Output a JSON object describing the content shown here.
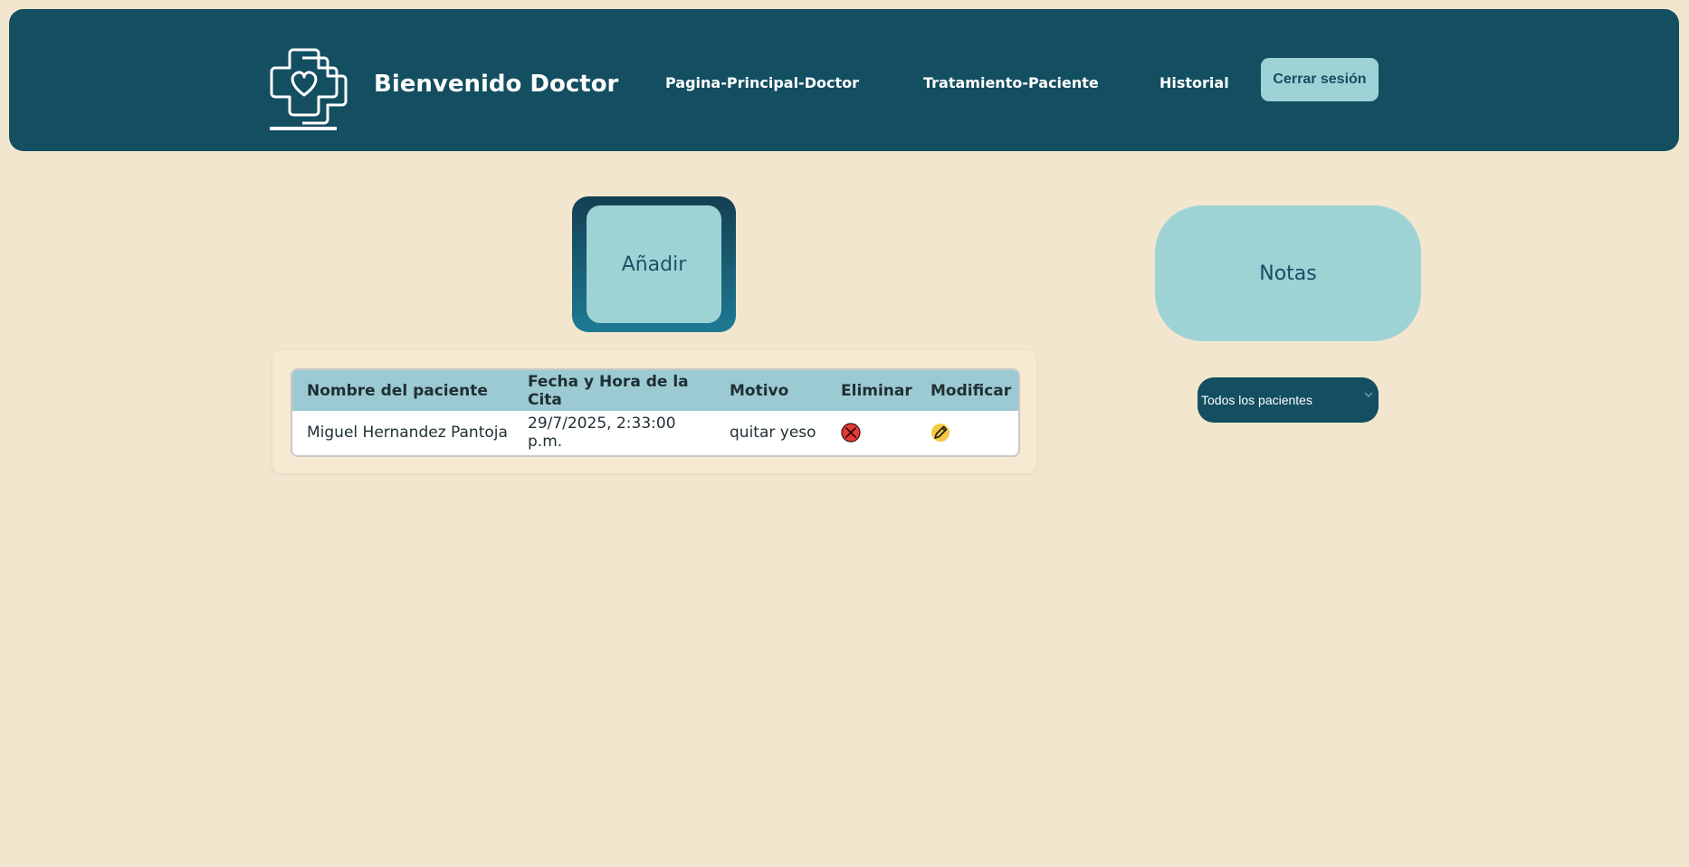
{
  "header": {
    "title": "Bienvenido Doctor",
    "nav": [
      "Pagina-Principal-Doctor",
      "Tratamiento-Paciente",
      "Historial"
    ],
    "logout_label": "Cerrar sesión"
  },
  "actions": {
    "add_label": "Añadir",
    "notes_label": "Notas"
  },
  "filter": {
    "selected": "Todos los pacientes"
  },
  "table": {
    "columns": [
      "Nombre del paciente",
      "Fecha y Hora de la Cita",
      "Motivo",
      "Eliminar",
      "Modificar"
    ],
    "rows": [
      {
        "name": "Miguel Hernandez Pantoja",
        "datetime": "29/7/2025, 2:33:00 p.m.",
        "reason": "quitar yeso",
        "delete_icon": "delete-icon",
        "edit_icon": "edit-pencil-icon"
      }
    ]
  },
  "colors": {
    "background": "#f3e6cf",
    "header": "#134e61",
    "accent": "#9ed3d6",
    "delete": "#e53935",
    "edit": "#f5c842"
  }
}
